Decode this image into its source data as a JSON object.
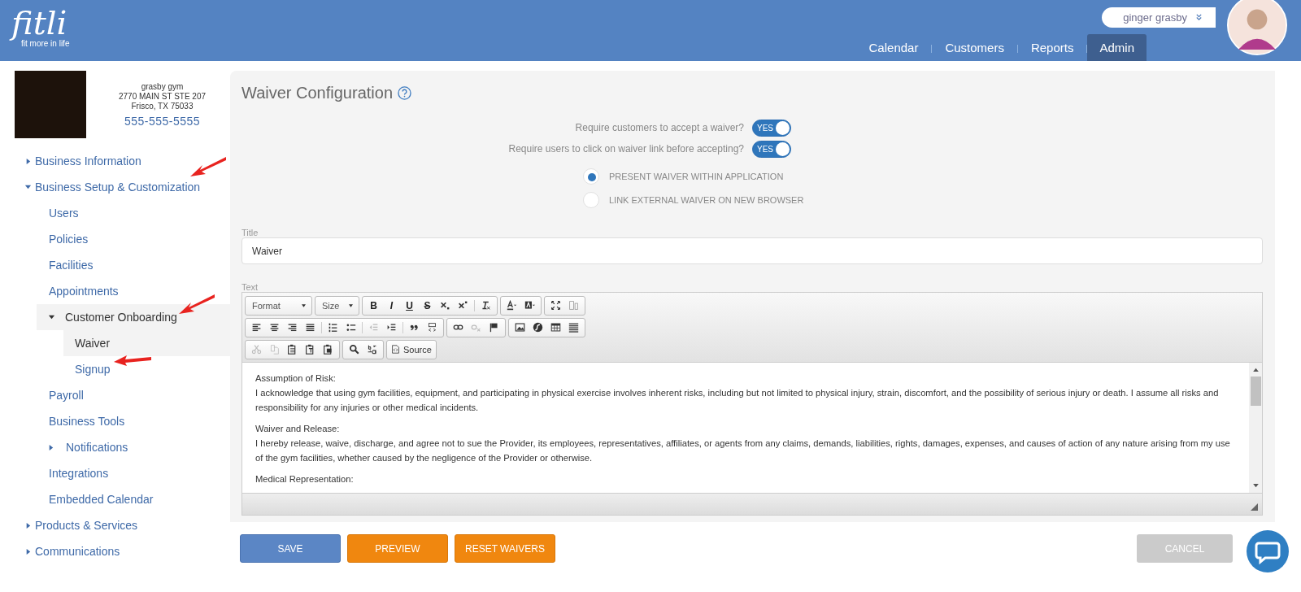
{
  "header": {
    "logo": {
      "wordmark": "fitli",
      "tagline": "fit more in life"
    },
    "user_menu": {
      "name": "ginger grasby"
    },
    "nav": [
      {
        "label": "Calendar",
        "selected": false
      },
      {
        "label": "Customers",
        "selected": false
      },
      {
        "label": "Reports",
        "selected": false
      },
      {
        "label": "Admin",
        "selected": true
      }
    ]
  },
  "business": {
    "name": "grasby gym",
    "address_line_1": "2770 MAIN ST STE 207",
    "address_line_2": "Frisco, TX 75033",
    "phone": "555-555-5555"
  },
  "sidebar": {
    "items": [
      {
        "label": "Business Information",
        "expanded": false,
        "selected": false
      },
      {
        "label": "Business Setup & Customization",
        "expanded": true,
        "selected": false,
        "children": [
          {
            "label": "Users",
            "selected": false
          },
          {
            "label": "Policies",
            "selected": false
          },
          {
            "label": "Facilities",
            "selected": false
          },
          {
            "label": "Appointments",
            "selected": false
          },
          {
            "label": "Customer Onboarding",
            "expanded": true,
            "selected": true,
            "children": [
              {
                "label": "Waiver",
                "selected": true
              },
              {
                "label": "Signup",
                "selected": false
              }
            ]
          },
          {
            "label": "Payroll",
            "selected": false
          },
          {
            "label": "Business Tools",
            "selected": false
          },
          {
            "label": "Notifications",
            "expanded": false,
            "selected": false
          },
          {
            "label": "Integrations",
            "selected": false
          },
          {
            "label": "Embedded Calendar",
            "selected": false
          }
        ]
      },
      {
        "label": "Products & Services",
        "expanded": false,
        "selected": false
      },
      {
        "label": "Communications",
        "expanded": false,
        "selected": false
      }
    ]
  },
  "page": {
    "title": "Waiver Configuration",
    "toggles": [
      {
        "label": "Require customers to accept a waiver?",
        "on": true,
        "state_text": "YES"
      },
      {
        "label": "Require users to click on waiver link before accepting?",
        "on": true,
        "state_text": "YES"
      }
    ],
    "radios": [
      {
        "label": "PRESENT WAIVER WITHIN APPLICATION",
        "selected": true
      },
      {
        "label": "LINK EXTERNAL WAIVER ON NEW BROWSER",
        "selected": false
      }
    ],
    "title_field": {
      "label": "Title",
      "value": "Waiver"
    },
    "text_editor": {
      "label": "Text",
      "toolbar": {
        "format": "Format",
        "size": "Size",
        "bold": "B",
        "italic": "I",
        "underline": "U",
        "strike": "S",
        "source": "Source"
      },
      "paragraphs": [
        {
          "heading": "Assumption of Risk:",
          "body": "I acknowledge that using gym facilities, equipment, and participating in physical exercise involves inherent risks, including but not limited to physical injury, strain, discomfort, and the possibility of serious injury or death. I assume all risks and responsibility for any injuries or other medical incidents."
        },
        {
          "heading": "Waiver and Release:",
          "body": "I hereby release, waive, discharge, and agree not to sue the Provider, its employees, representatives, affiliates, or agents from any claims, demands, liabilities, rights, damages, expenses, and causes of action of any nature arising from my use of the gym facilities, whether caused by the negligence of the Provider or otherwise."
        },
        {
          "heading": "Medical Representation:"
        }
      ]
    },
    "buttons": [
      {
        "label": "SAVE",
        "kind": "primary"
      },
      {
        "label": "PREVIEW",
        "kind": "accent"
      },
      {
        "label": "RESET WAIVERS",
        "kind": "accent"
      },
      {
        "label": "CANCEL",
        "kind": "muted"
      }
    ]
  }
}
